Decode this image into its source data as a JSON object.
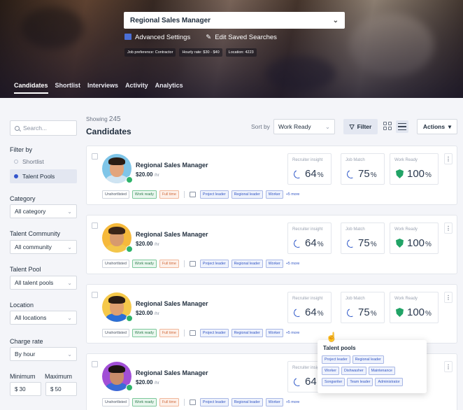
{
  "hero": {
    "job_title": "Regional Sales Manager",
    "advanced_settings": "Advanced Settings",
    "edit_saved_searches": "Edit Saved Searches",
    "chips": [
      "Job preference: Contractor",
      "Hourly rate: $30 - $40",
      "Location: 4223"
    ],
    "tabs": [
      "Candidates",
      "Shortlist",
      "Interviews",
      "Activity",
      "Analytics"
    ],
    "active_tab": "Candidates"
  },
  "sidebar": {
    "search_placeholder": "Search...",
    "filter_by": "Filter by",
    "filter_options": [
      "Shortlist",
      "Talent Pools"
    ],
    "category_label": "Category",
    "category_value": "All category",
    "community_label": "Talent Community",
    "community_value": "All community",
    "pool_label": "Talent Pool",
    "pool_value": "All talent pools",
    "location_label": "Location",
    "location_value": "All locations",
    "charge_label": "Charge rate",
    "charge_value": "By hour",
    "min_label": "Minimum",
    "max_label": "Maximum",
    "min_value": "$ 30",
    "max_value": "$ 50"
  },
  "list": {
    "showing_label": "Showing",
    "showing_count": "245",
    "title": "Candidates",
    "sort_label": "Sort by",
    "sort_value": "Work Ready",
    "filter_label": "Filter",
    "actions_label": "Actions"
  },
  "metrics_labels": {
    "recruiter": "Recruiter insight",
    "match": "Job Match",
    "ready": "Work Ready"
  },
  "candidates": [
    {
      "role": "Regional Sales Manager",
      "rate": "$20.00",
      "unit": "/hr",
      "recruiter": "64",
      "match": "75",
      "ready": "100",
      "percent": "%"
    },
    {
      "role": "Regional Sales Manager",
      "rate": "$20.00",
      "unit": "/hr",
      "recruiter": "64",
      "match": "75",
      "ready": "100",
      "percent": "%"
    },
    {
      "role": "Regional Sales Manager",
      "rate": "$20.00",
      "unit": "/hr",
      "recruiter": "64",
      "match": "75",
      "ready": "100",
      "percent": "%"
    },
    {
      "role": "Regional Sales Manager",
      "rate": "$20.00",
      "unit": "/hr",
      "recruiter": "64",
      "match": "",
      "ready": "",
      "percent": "%"
    }
  ],
  "tags": {
    "unshortlisted": "Unshortlisted",
    "work_ready": "Work ready",
    "full_time": "Full time",
    "project_leader": "Project leader",
    "regional_leader": "Regional leader",
    "worker": "Worker",
    "more": "+5 more"
  },
  "popup": {
    "title": "Talent pools",
    "rows": [
      [
        "Project leader",
        "Regional leader"
      ],
      [
        "Worker",
        "Dishwasher",
        "Maintenance"
      ],
      [
        "Songwriter",
        "Team leader",
        "Administrator"
      ]
    ]
  },
  "colors": {
    "accent": "#2f59c9",
    "success": "#21a366",
    "warning": "#d06a3c"
  }
}
